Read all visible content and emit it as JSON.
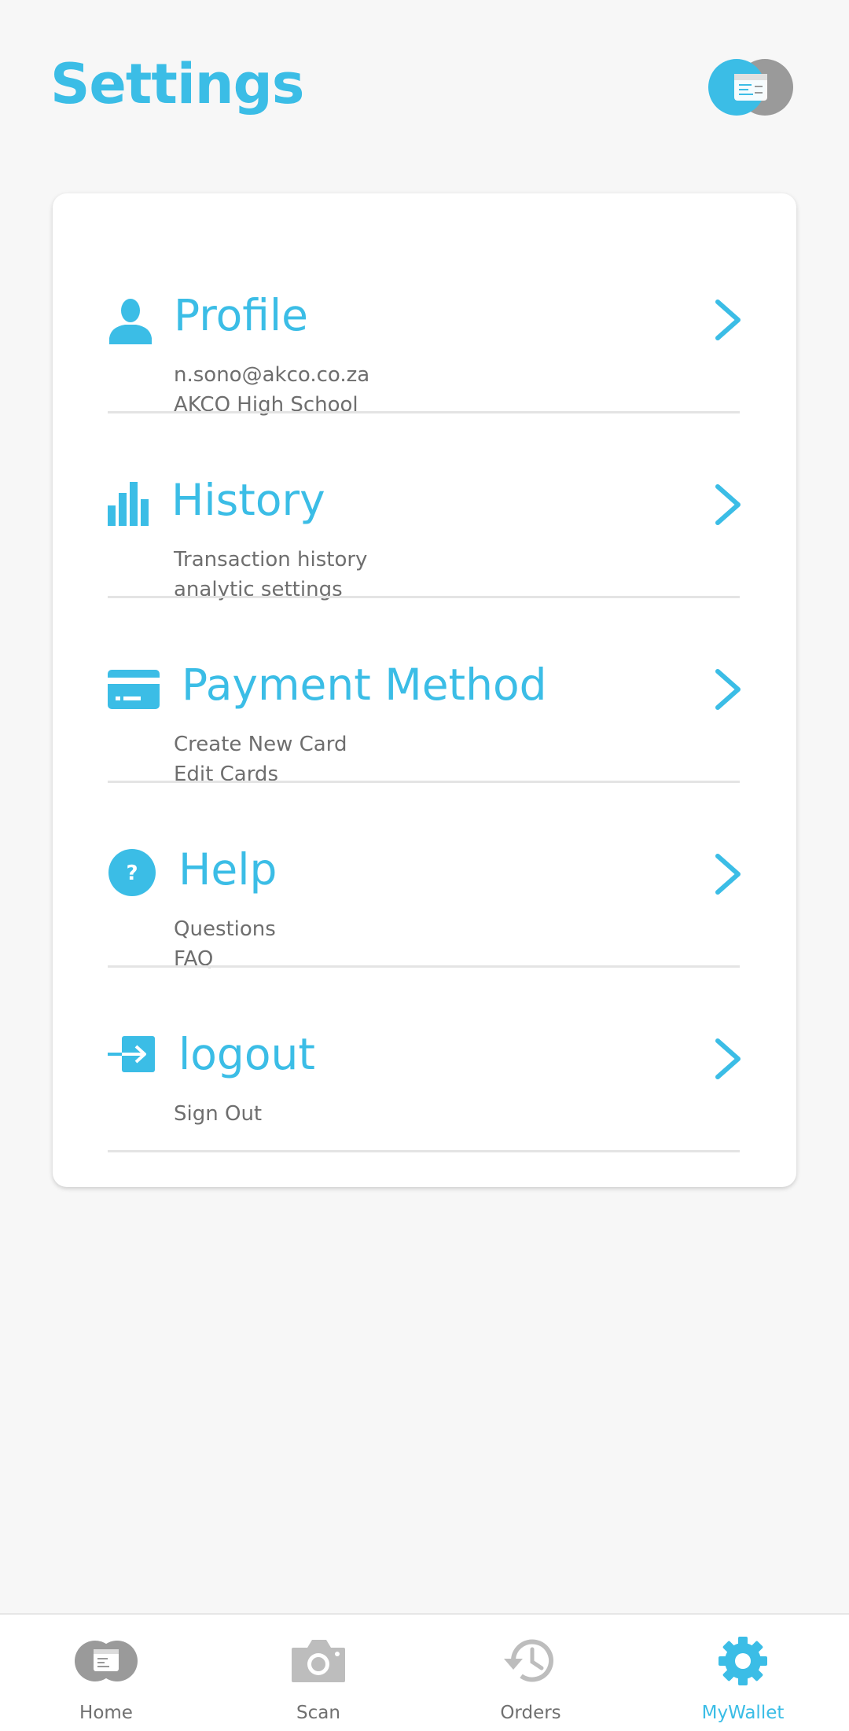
{
  "header": {
    "title": "Settings",
    "logo_icon": "wallet-logo-icon"
  },
  "settings": {
    "items": [
      {
        "icon": "person-icon",
        "title": "Profile",
        "lines": [
          "n.sono@akco.co.za",
          "AKCO High School"
        ]
      },
      {
        "icon": "bar-chart-icon",
        "title": "History",
        "lines": [
          "Transaction history",
          "analytic settings"
        ]
      },
      {
        "icon": "credit-card-icon",
        "title": "Payment Method",
        "lines": [
          "Create New Card",
          "Edit Cards"
        ]
      },
      {
        "icon": "question-circle-icon",
        "title": "Help",
        "lines": [
          "Questions",
          "FAQ"
        ]
      },
      {
        "icon": "logout-arrow-icon",
        "title": "logout",
        "lines": [
          "Sign Out"
        ]
      }
    ]
  },
  "bottom_nav": {
    "items": [
      {
        "label": "Home",
        "icon": "wallet-icon",
        "active": false
      },
      {
        "label": "Scan",
        "icon": "camera-icon",
        "active": false
      },
      {
        "label": "Orders",
        "icon": "history-clock-icon",
        "active": false
      },
      {
        "label": "MyWallet",
        "icon": "gear-icon",
        "active": true
      }
    ]
  },
  "colors": {
    "accent": "#3bbde6",
    "muted_text": "#6e6e6e",
    "inactive_icon": "#a0a0a0",
    "background": "#f7f7f7"
  }
}
